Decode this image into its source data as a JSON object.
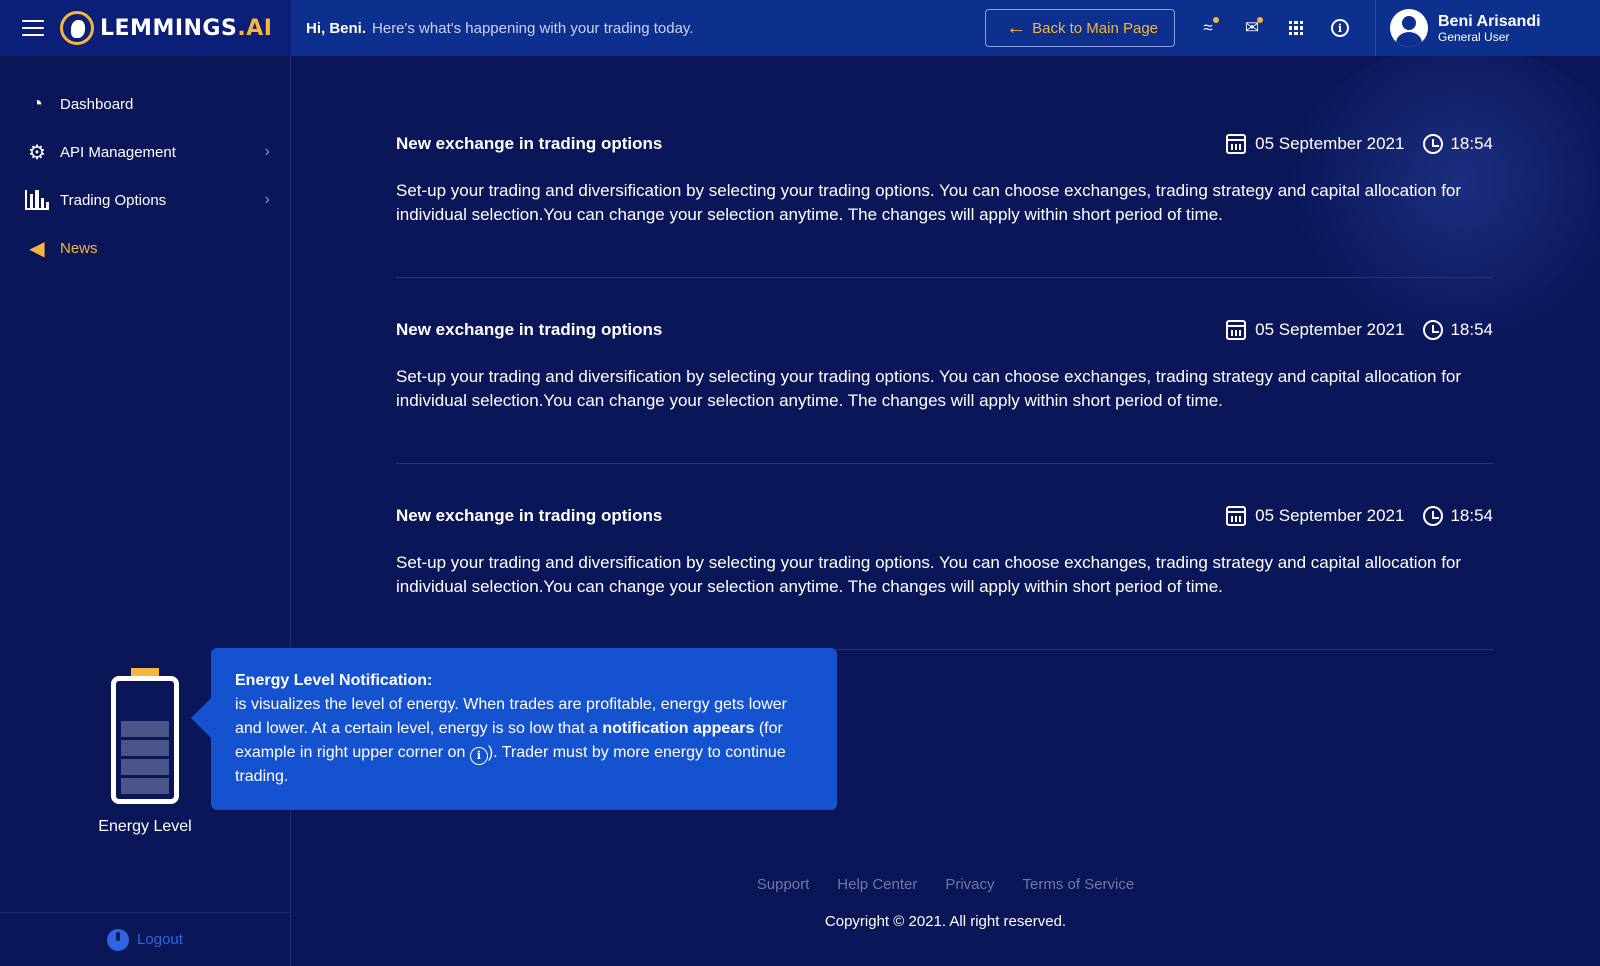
{
  "brand": {
    "name": "LEMMINGS",
    "suffix": ".AI"
  },
  "header": {
    "greeting_name": "Hi, Beni.",
    "greeting_text": "Here's what's happening with your trading today.",
    "back_button": "Back to Main Page"
  },
  "user": {
    "name": "Beni Arisandi",
    "role": "General User"
  },
  "sidebar": {
    "items": [
      {
        "label": "Dashboard",
        "icon": "speedometer-icon"
      },
      {
        "label": "API Management",
        "icon": "api-icon"
      },
      {
        "label": "Trading Options",
        "icon": "bar-chart-icon"
      },
      {
        "label": "News",
        "icon": "megaphone-icon",
        "active": true
      }
    ],
    "logout": "Logout"
  },
  "news": [
    {
      "title": "New exchange in trading options",
      "date": "05 September 2021",
      "time": "18:54",
      "body": "Set-up your trading and diversification by selecting your trading options. You can choose exchanges, trading strategy and capital allocation for individual selection.You can change your selection anytime. The changes will apply within short period of time."
    },
    {
      "title": "New exchange in trading options",
      "date": "05 September 2021",
      "time": "18:54",
      "body": "Set-up your trading and diversification by selecting your trading options. You can choose exchanges, trading strategy and capital allocation for individual selection.You can change your selection anytime. The changes will apply within short period of time."
    },
    {
      "title": "New exchange in trading options",
      "date": "05 September 2021",
      "time": "18:54",
      "body": "Set-up your trading and diversification by selecting your trading options. You can choose exchanges, trading strategy and capital allocation for individual selection.You can change your selection anytime. The changes will apply within short period of time."
    }
  ],
  "energy": {
    "label": "Energy Level",
    "tooltip_title": "Energy Level Notification:",
    "tooltip_text_1": "is visualizes the level of energy. When trades are profitable, energy gets lower and lower. At a certain level, energy is so low that a",
    "tooltip_bold": "notification appears",
    "tooltip_text_2": "(for example in right upper corner on",
    "tooltip_text_3": "). Trader must by more energy to continue trading."
  },
  "footer": {
    "links": [
      "Support",
      "Help Center",
      "Privacy",
      "Terms of Service"
    ],
    "copyright": "Copyright © 2021. All right reserved."
  },
  "colors": {
    "accent": "#f4b63d",
    "topbar": "#0d2f8e",
    "background": "#0b1659",
    "tooltip": "#1552cf"
  }
}
